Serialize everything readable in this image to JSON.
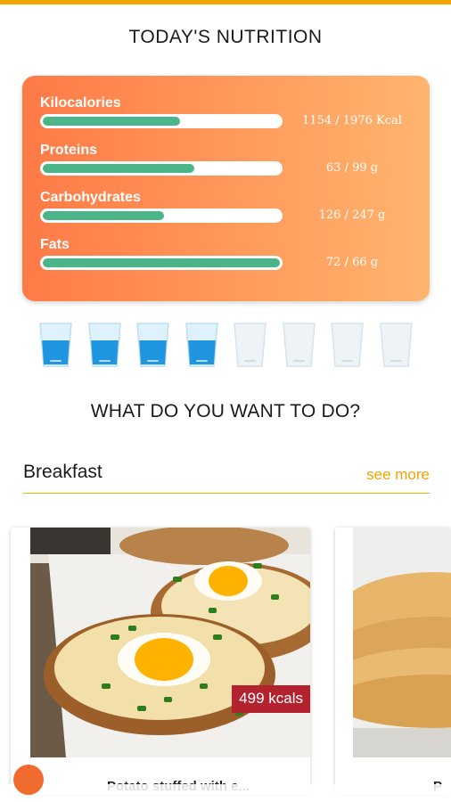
{
  "header": {
    "title": "TODAY'S NUTRITION"
  },
  "nutrition": [
    {
      "label": "Kilocalories",
      "value": "1154 / 1976 Kcal",
      "progress": 0.58
    },
    {
      "label": "Proteins",
      "value": "63 / 99 g",
      "progress": 0.64
    },
    {
      "label": "Carbohydrates",
      "value": "126 / 247 g",
      "progress": 0.51
    },
    {
      "label": "Fats",
      "value": "72 / 66 g",
      "progress": 1.0
    }
  ],
  "water": {
    "glasses_total": 8,
    "glasses_filled": 4,
    "icon": "water-glass-icon"
  },
  "question": "WHAT DO YOU WANT TO DO?",
  "section": {
    "title": "Breakfast",
    "see_more": "see more"
  },
  "recipes": [
    {
      "kcal_badge": "499 kcals",
      "name": "Potato stuffed with e..."
    },
    {
      "kcal_badge": "",
      "name": "P"
    }
  ],
  "colors": {
    "accent": "#f0a500",
    "bar_fill": "#4cb489",
    "card_from": "#ff7a46",
    "card_to": "#ffb56f",
    "badge": "#b5222f",
    "water": "#2196e0"
  }
}
